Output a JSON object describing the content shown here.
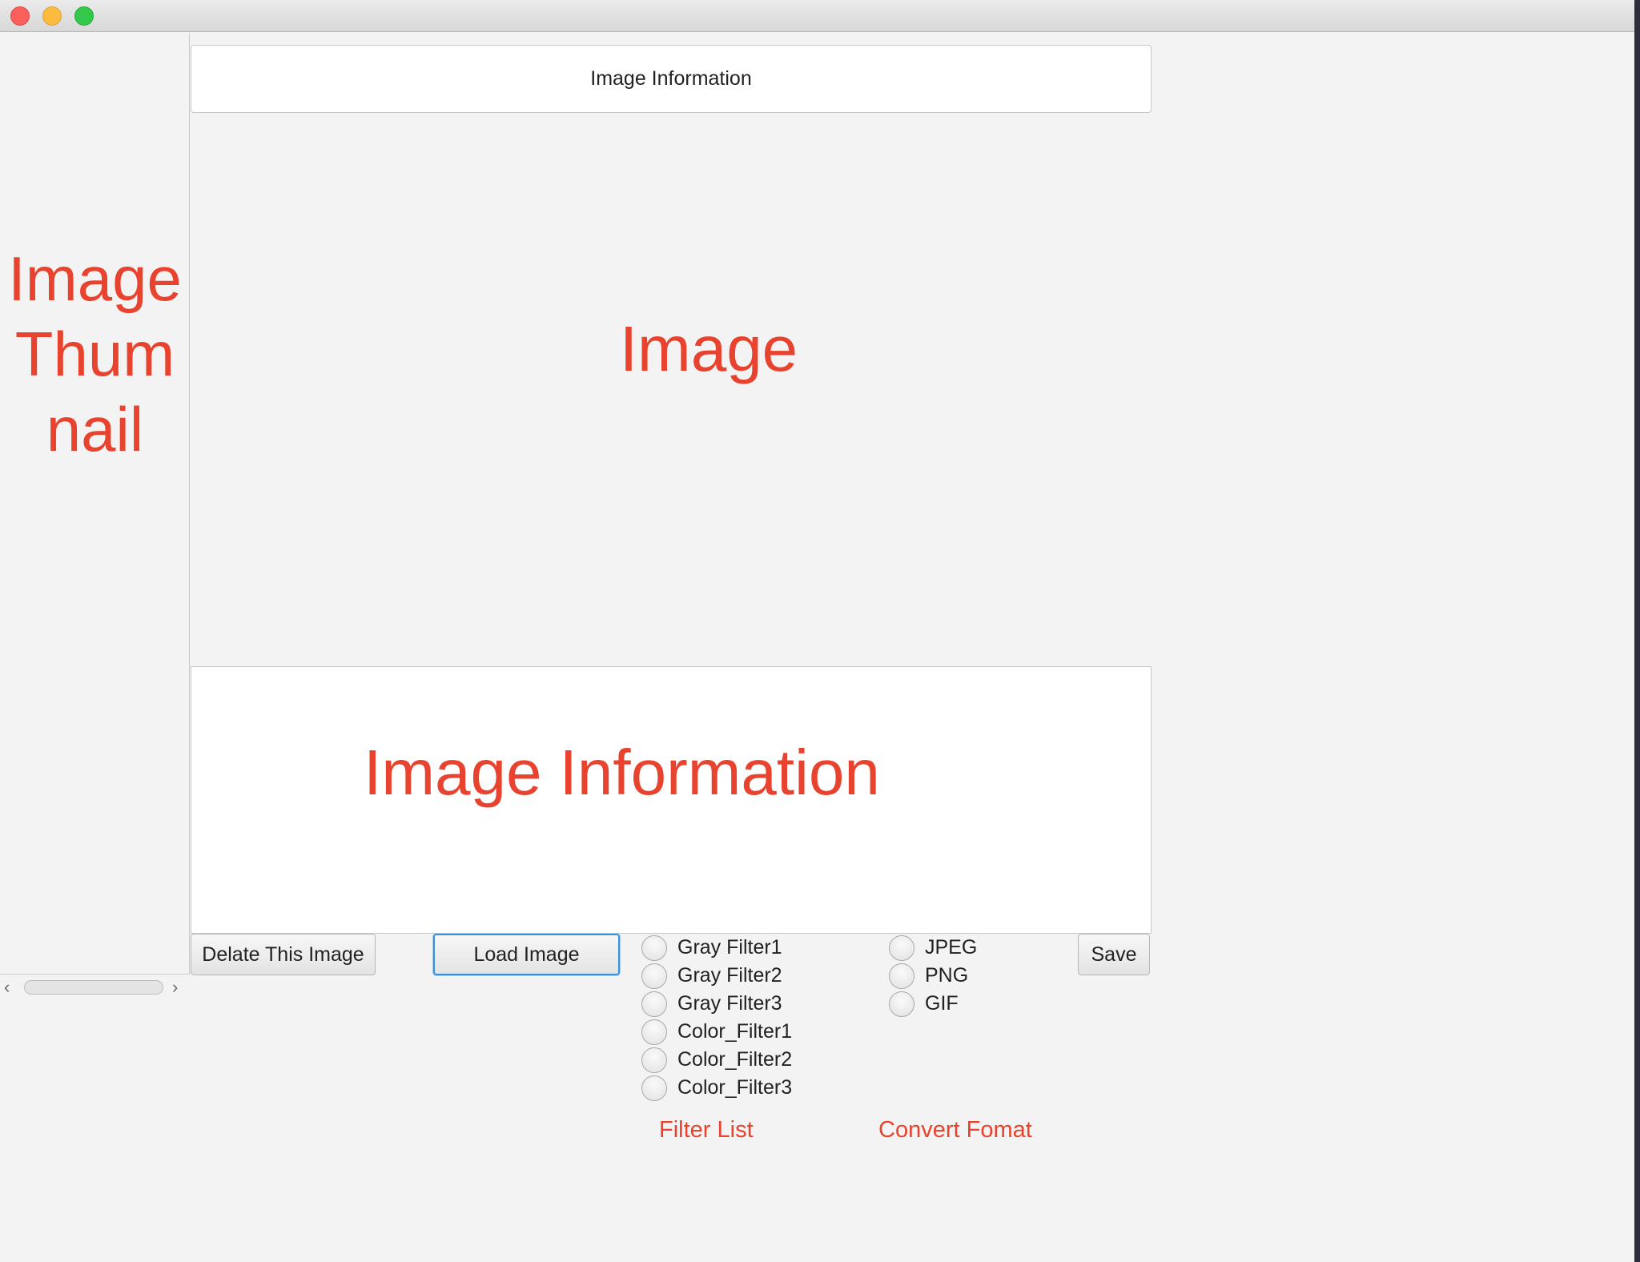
{
  "window": {
    "title": ""
  },
  "sidebar": {
    "thumbnail_label": "Image Thumbnail"
  },
  "top_info": {
    "text": "Image Information"
  },
  "image_area": {
    "label": "Image"
  },
  "info_area": {
    "label": "Image Information"
  },
  "buttons": {
    "delete": "Delate This Image",
    "load": "Load Image",
    "save": "Save"
  },
  "filters": {
    "caption": "Filter List",
    "items": [
      "Gray Filter1",
      "Gray Filter2",
      "Gray Filter3",
      "Color_Filter1",
      "Color_Filter2",
      "Color_Filter3"
    ]
  },
  "formats": {
    "caption": "Convert Fomat",
    "items": [
      "JPEG",
      "PNG",
      "GIF"
    ]
  },
  "colors": {
    "annotation": "#e8432e",
    "focus": "#3a90d9"
  }
}
